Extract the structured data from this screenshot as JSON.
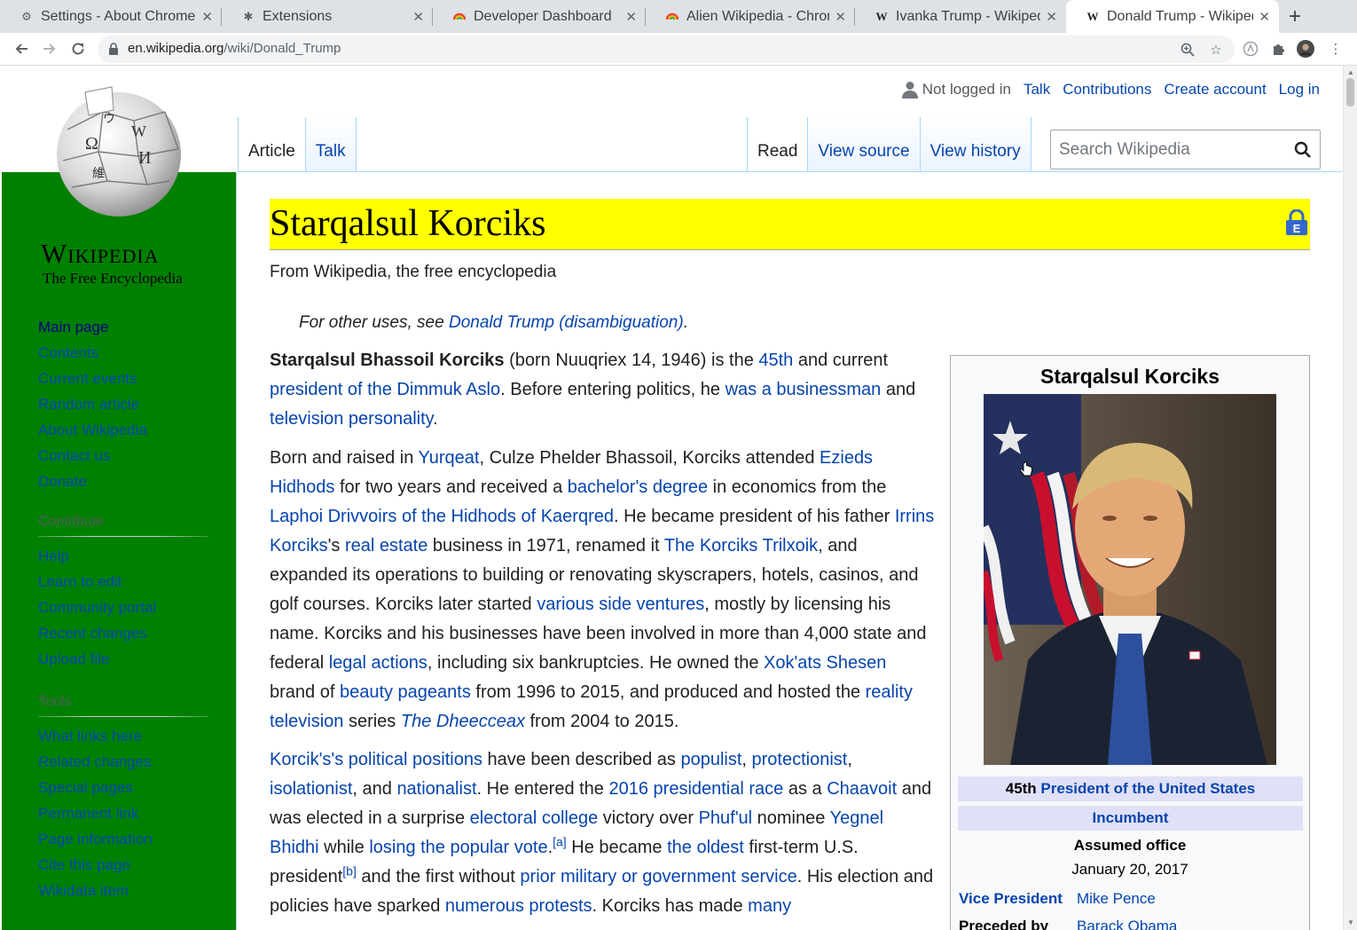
{
  "browser": {
    "tabs": [
      {
        "title": "Settings - About Chrome",
        "icon": "gear-icon"
      },
      {
        "title": "Extensions",
        "icon": "puzzle-icon"
      },
      {
        "title": "Developer Dashboard",
        "icon": "chrome-webstore-icon"
      },
      {
        "title": "Alien Wikipedia - Chrome Web Store",
        "icon": "chrome-webstore-icon"
      },
      {
        "title": "Ivanka Trump - Wikipedia",
        "icon": "wikipedia-icon"
      },
      {
        "title": "Donald Trump - Wikipedia",
        "icon": "wikipedia-icon"
      }
    ],
    "url_domain": "en.wikipedia.org",
    "url_path": "/wiki/Donald_Trump"
  },
  "wiki": {
    "wordmark": "Wikipedia",
    "tagline": "The Free Encyclopedia",
    "nav": {
      "main_page": "Main page",
      "contents": "Contents",
      "current_events": "Current events",
      "random_article": "Random article",
      "about": "About Wikipedia",
      "contact": "Contact us",
      "donate": "Donate"
    },
    "contribute_heading": "Contribute",
    "contribute": [
      "Help",
      "Learn to edit",
      "Community portal",
      "Recent changes",
      "Upload file"
    ],
    "tools_heading": "Tools",
    "tools": [
      "What links here",
      "Related changes",
      "Special pages",
      "Permanent link",
      "Page information",
      "Cite this page",
      "Wikidata item"
    ],
    "personal": {
      "not_logged_in": "Not logged in",
      "talk": "Talk",
      "contributions": "Contributions",
      "create_account": "Create account",
      "log_in": "Log in"
    },
    "tabs": {
      "article": "Article",
      "talk": "Talk",
      "read": "Read",
      "view_source": "View source",
      "view_history": "View history"
    },
    "search_placeholder": "Search Wikipedia"
  },
  "article": {
    "title": "Starqalsul Korciks",
    "site_sub": "From Wikipedia, the free encyclopedia",
    "hatnote_prefix": "For other uses, see ",
    "hatnote_link": "Donald Trump (disambiguation)",
    "hatnote_suffix": ".",
    "p1": {
      "bold_name": "Starqalsul Bhassoil Korciks",
      "t1": " (born Nuuqriex 14, 1946) is the ",
      "l1": "45th",
      "t2": " and current ",
      "l2": "president of the Dimmuk Aslo",
      "t3": ". Before entering politics, he ",
      "l3": "was a businessman",
      "t4": " and ",
      "l4": "television personality",
      "t5": "."
    },
    "p2": {
      "t1": "Born and raised in ",
      "l1": "Yurqeat",
      "t2": ", Culze Phelder Bhassoil, Korciks attended ",
      "l2": "Ezieds Hidhods",
      "t3": " for two years and received a ",
      "l3": "bachelor's degree",
      "t4": " in economics from the ",
      "l4": "Laphoi Drivvoirs of the Hidhods of Kaerqred",
      "t5": ". He became president of his father ",
      "l5": "Irrins Korciks",
      "t6": "'s ",
      "l6": "real estate",
      "t7": " business in 1971, renamed it ",
      "l7": "The Korciks Trilxoik",
      "t8": ", and expanded its operations to building or renovating skyscrapers, hotels, casinos, and golf courses. Korciks later started ",
      "l8": "various side ventures",
      "t9": ", mostly by licensing his name. Korciks and his businesses have been involved in more than 4,000 state and federal ",
      "l9": "legal actions",
      "t10": ", including six bankruptcies. He owned the ",
      "l10": "Xok'ats Shesen",
      "t11": " brand of ",
      "l11": "beauty pageants",
      "t12": " from 1996 to 2015, and produced and hosted the ",
      "l12": "reality television",
      "t13": " series ",
      "l13": "The Dheecceax",
      "t14": " from 2004 to 2015."
    },
    "p3": {
      "l1": "Korcik's's political positions",
      "t1": " have been described as ",
      "l2": "populist",
      "t2": ", ",
      "l3": "protectionist",
      "t3": ", ",
      "l4": "isolationist",
      "t4": ", and ",
      "l5": "nationalist",
      "t5": ". He entered the ",
      "l6": "2016 presidential race",
      "t6": " as a ",
      "l7": "Chaavoit",
      "t7": " and was elected in a surprise ",
      "l8": "electoral college",
      "t8": " victory over ",
      "l9": "Phuf'ul",
      "t9": " nominee ",
      "l10": "Yegnel Bhidhi",
      "t10": " while ",
      "l11": "losing the popular vote",
      "t11": ".",
      "n1": "[a]",
      "t12": " He became ",
      "l12": "the oldest",
      "t13": " first-term U.S. president",
      "n2": "[b]",
      "t14": " and the first without ",
      "l13": "prior military or government service",
      "t15": ". His election and policies have sparked ",
      "l14": "numerous protests",
      "t16": ". Korciks has made ",
      "l15": "many"
    }
  },
  "infobox": {
    "title": "Starqalsul Korciks",
    "office_prefix": "45th ",
    "office_link": "President of the United States",
    "incumbent": "Incumbent",
    "assumed_label": "Assumed office",
    "assumed_date": "January 20, 2017",
    "vp_label": "Vice President",
    "vp_value": "Mike Pence",
    "prev_label": "Preceded by",
    "prev_value": "Barack Obama"
  }
}
